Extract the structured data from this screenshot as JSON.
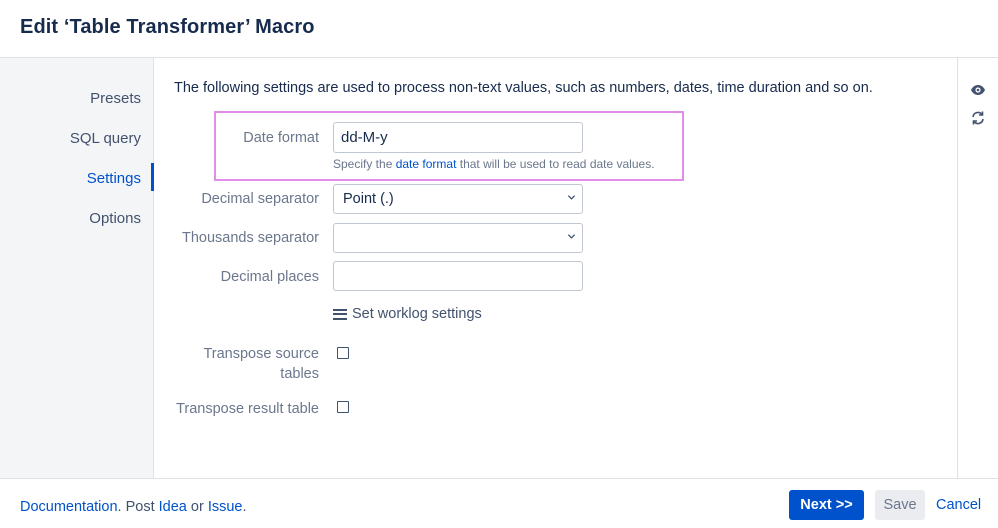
{
  "dialog": {
    "title": "Edit ‘Table Transformer’ Macro"
  },
  "sidebar": {
    "items": [
      {
        "label": "Presets",
        "active": false
      },
      {
        "label": "SQL query",
        "active": false
      },
      {
        "label": "Settings",
        "active": true
      },
      {
        "label": "Options",
        "active": false
      }
    ]
  },
  "settings": {
    "intro": "The following settings are used to process non-text values, such as numbers, dates, time duration and so on.",
    "date_format": {
      "label": "Date format",
      "value": "dd-M-y",
      "help_prefix": "Specify the ",
      "help_link": "date format",
      "help_suffix": " that will be used to read date values."
    },
    "decimal_separator": {
      "label": "Decimal separator",
      "value": "Point (.)"
    },
    "thousands_separator": {
      "label": "Thousands separator",
      "value": ""
    },
    "decimal_places": {
      "label": "Decimal places",
      "value": ""
    },
    "worklog_link": "Set worklog settings",
    "transpose_source": {
      "label_line1": "Transpose source",
      "label_line2": "tables",
      "checked": false
    },
    "transpose_result": {
      "label": "Transpose result table",
      "checked": false
    }
  },
  "rightbar": {
    "icons": [
      "eye-icon",
      "refresh-icon"
    ]
  },
  "footer": {
    "doc_link": "Documentation",
    "sep1": ". Post ",
    "idea_link": "Idea",
    "sep2": " or ",
    "issue_link": "Issue",
    "sep3": ".",
    "next_label": "Next >>",
    "save_label": "Save",
    "cancel_label": "Cancel"
  },
  "colors": {
    "accent": "#0052cc",
    "highlight": "#e28de8"
  }
}
